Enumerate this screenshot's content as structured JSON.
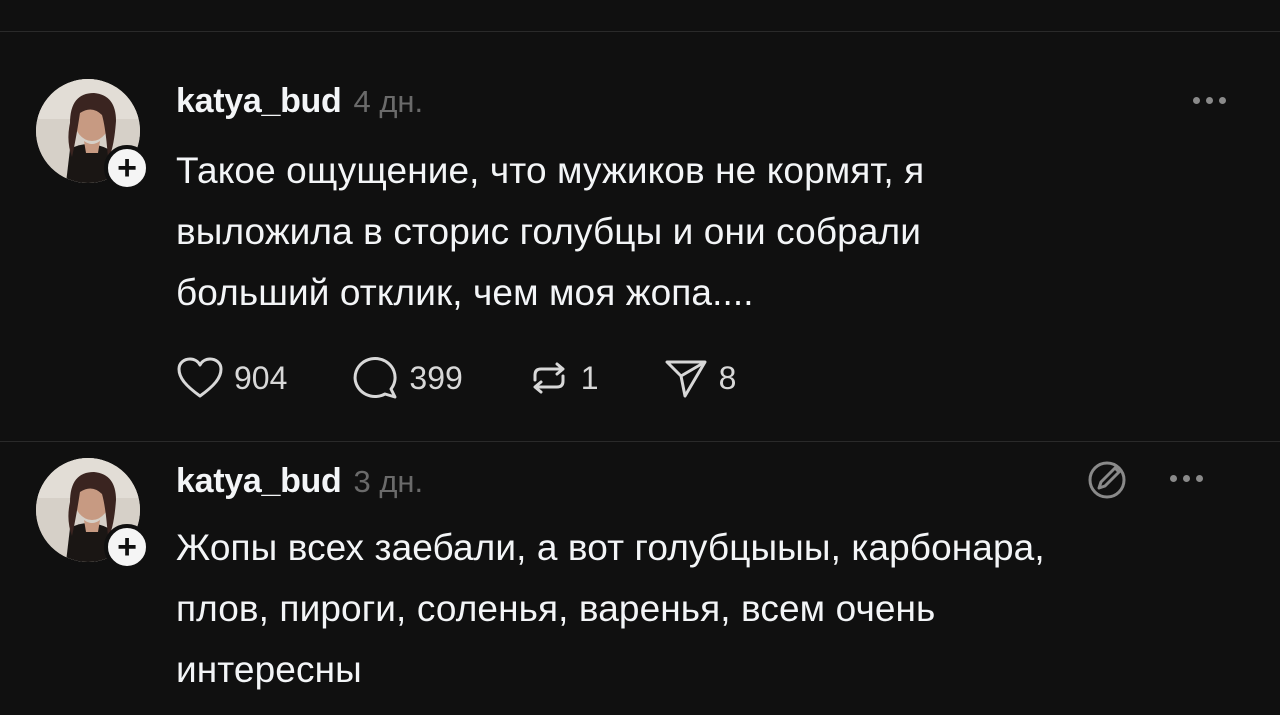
{
  "posts": [
    {
      "username": "katya_bud",
      "timestamp": "4 дн.",
      "text_lines": [
        "Такое ощущение, что мужиков не кормят, я",
        "выложила в сторис голубцы и они собрали",
        "больший отклик, чем моя жопа...."
      ],
      "follow_symbol": "+",
      "actions": {
        "likes": "904",
        "comments": "399",
        "reposts": "1",
        "shares": "8"
      }
    },
    {
      "username": "katya_bud",
      "timestamp": "3 дн.",
      "text_lines": [
        "Жопы всех заебали, а вот голубцыыы, карбонара,",
        "плов, пироги, соленья, варенья, всем очень",
        "интересны"
      ],
      "follow_symbol": "+"
    }
  ],
  "icons": {
    "like": "heart-icon",
    "comment": "comment-bubble-icon",
    "repost": "repost-icon",
    "share": "send-icon",
    "more": "more-horizontal-icon",
    "edit": "edit-pencil-icon"
  },
  "colors": {
    "background": "#101010",
    "text_primary": "#f3f5f7",
    "text_secondary": "#6a6a6a",
    "divider": "#2a2a2a"
  }
}
